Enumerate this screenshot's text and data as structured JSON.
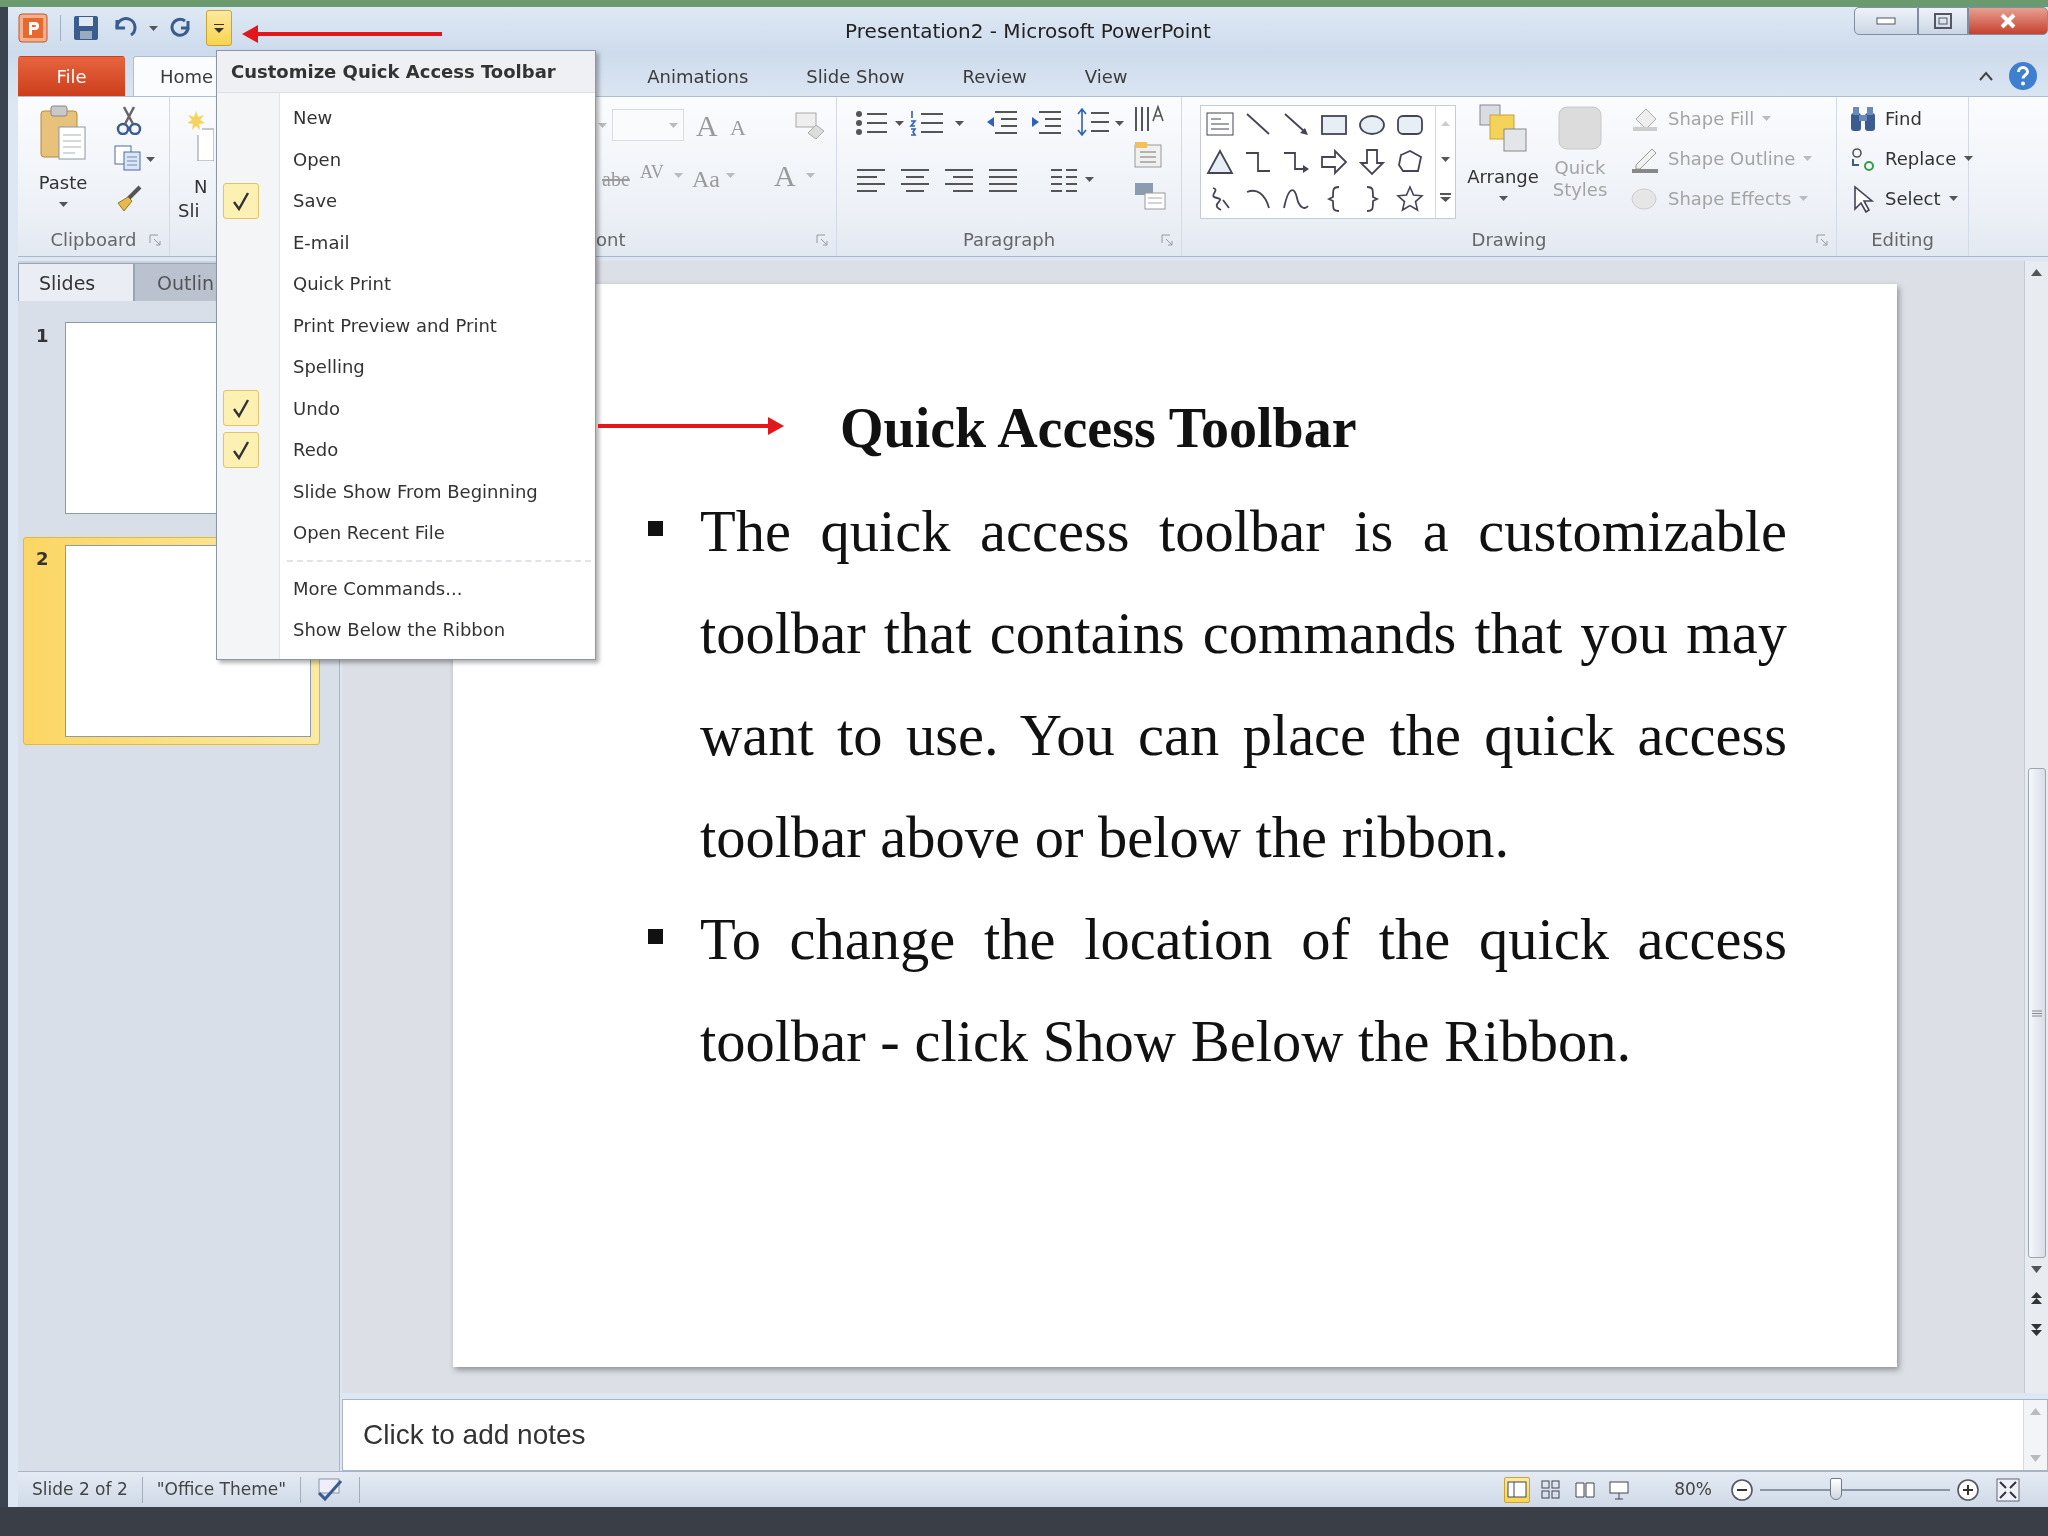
{
  "window": {
    "title": "Presentation2  -  Microsoft PowerPoint"
  },
  "quick_access_toolbar": {
    "customize_expanded": true
  },
  "ribbon_tabs": [
    {
      "kind": "file",
      "label": "File",
      "selected": false
    },
    {
      "kind": "tab",
      "label": "Home",
      "selected": true
    },
    {
      "kind": "tab",
      "label": "Animations",
      "selected": false
    },
    {
      "kind": "tab",
      "label": "Slide Show",
      "selected": false
    },
    {
      "kind": "tab",
      "label": "Review",
      "selected": false
    },
    {
      "kind": "tab",
      "label": "View",
      "selected": false
    }
  ],
  "ribbon": {
    "clipboard": {
      "label": "Clipboard",
      "paste": "Paste"
    },
    "slides": {
      "new_slide_line_1": "N",
      "new_slide_line_2": "Sli"
    },
    "font": {
      "label": "ont",
      "disabled": true,
      "grow": "A",
      "shrink": "A",
      "strikethrough": "abe",
      "spacing": "AV",
      "change_case": "Aa",
      "font_color": "A"
    },
    "paragraph": {
      "label": "Paragraph"
    },
    "drawing": {
      "label": "Drawing",
      "arrange": "Arrange",
      "quick_styles": {
        "label": "Quick Styles",
        "disabled": true
      },
      "shape_commands": [
        {
          "kind": "fill",
          "label": "Shape Fill",
          "disabled": true
        },
        {
          "kind": "outline",
          "label": "Shape Outline",
          "disabled": true
        },
        {
          "kind": "effects",
          "label": "Shape Effects",
          "disabled": true
        }
      ]
    },
    "editing": {
      "label": "Editing",
      "commands": [
        {
          "kind": "find",
          "label": "Find",
          "dropdown": false
        },
        {
          "kind": "replace",
          "label": "Replace",
          "dropdown": true
        },
        {
          "kind": "select",
          "label": "Select",
          "dropdown": true
        }
      ]
    }
  },
  "menu": {
    "title": "Customize Quick Access Toolbar",
    "items": [
      {
        "label": "New",
        "checked": false
      },
      {
        "label": "Open",
        "checked": false
      },
      {
        "label": "Save",
        "checked": true
      },
      {
        "label": "E-mail",
        "checked": false
      },
      {
        "label": "Quick Print",
        "checked": false
      },
      {
        "label": "Print Preview and Print",
        "checked": false
      },
      {
        "label": "Spelling",
        "checked": false
      },
      {
        "label": "Undo",
        "checked": true
      },
      {
        "label": "Redo",
        "checked": true
      },
      {
        "label": "Slide Show From Beginning",
        "checked": false
      },
      {
        "label": "Open Recent File",
        "checked": false
      }
    ],
    "footer_items": [
      "More Commands...",
      "Show Below the Ribbon"
    ]
  },
  "slides_panel": {
    "tabs": [
      {
        "label": "Slides",
        "selected": true
      },
      {
        "label": "Outlin",
        "selected": false
      }
    ],
    "thumbnails": [
      {
        "number": "1",
        "selected": false
      },
      {
        "number": "2",
        "selected": true
      }
    ]
  },
  "slide": {
    "title": "Quick Access Toolbar",
    "bullets": [
      "The quick access toolbar is a customizable toolbar that contains commands that you may want to use. You can place the quick access toolbar above or below the ribbon.",
      "To change the location of the quick access toolbar - click Show Below the Ribbon."
    ]
  },
  "notes": {
    "placeholder": "Click to add notes"
  },
  "status_bar": {
    "slide": "Slide 2 of 2",
    "theme": "\"Office Theme\"",
    "views": [
      {
        "kind": "normal",
        "selected": true
      },
      {
        "kind": "sorter",
        "selected": false
      },
      {
        "kind": "reading",
        "selected": false
      },
      {
        "kind": "slideshow",
        "selected": false
      }
    ],
    "zoom": "80%",
    "zoom_slider": {
      "level": 0.4
    }
  }
}
